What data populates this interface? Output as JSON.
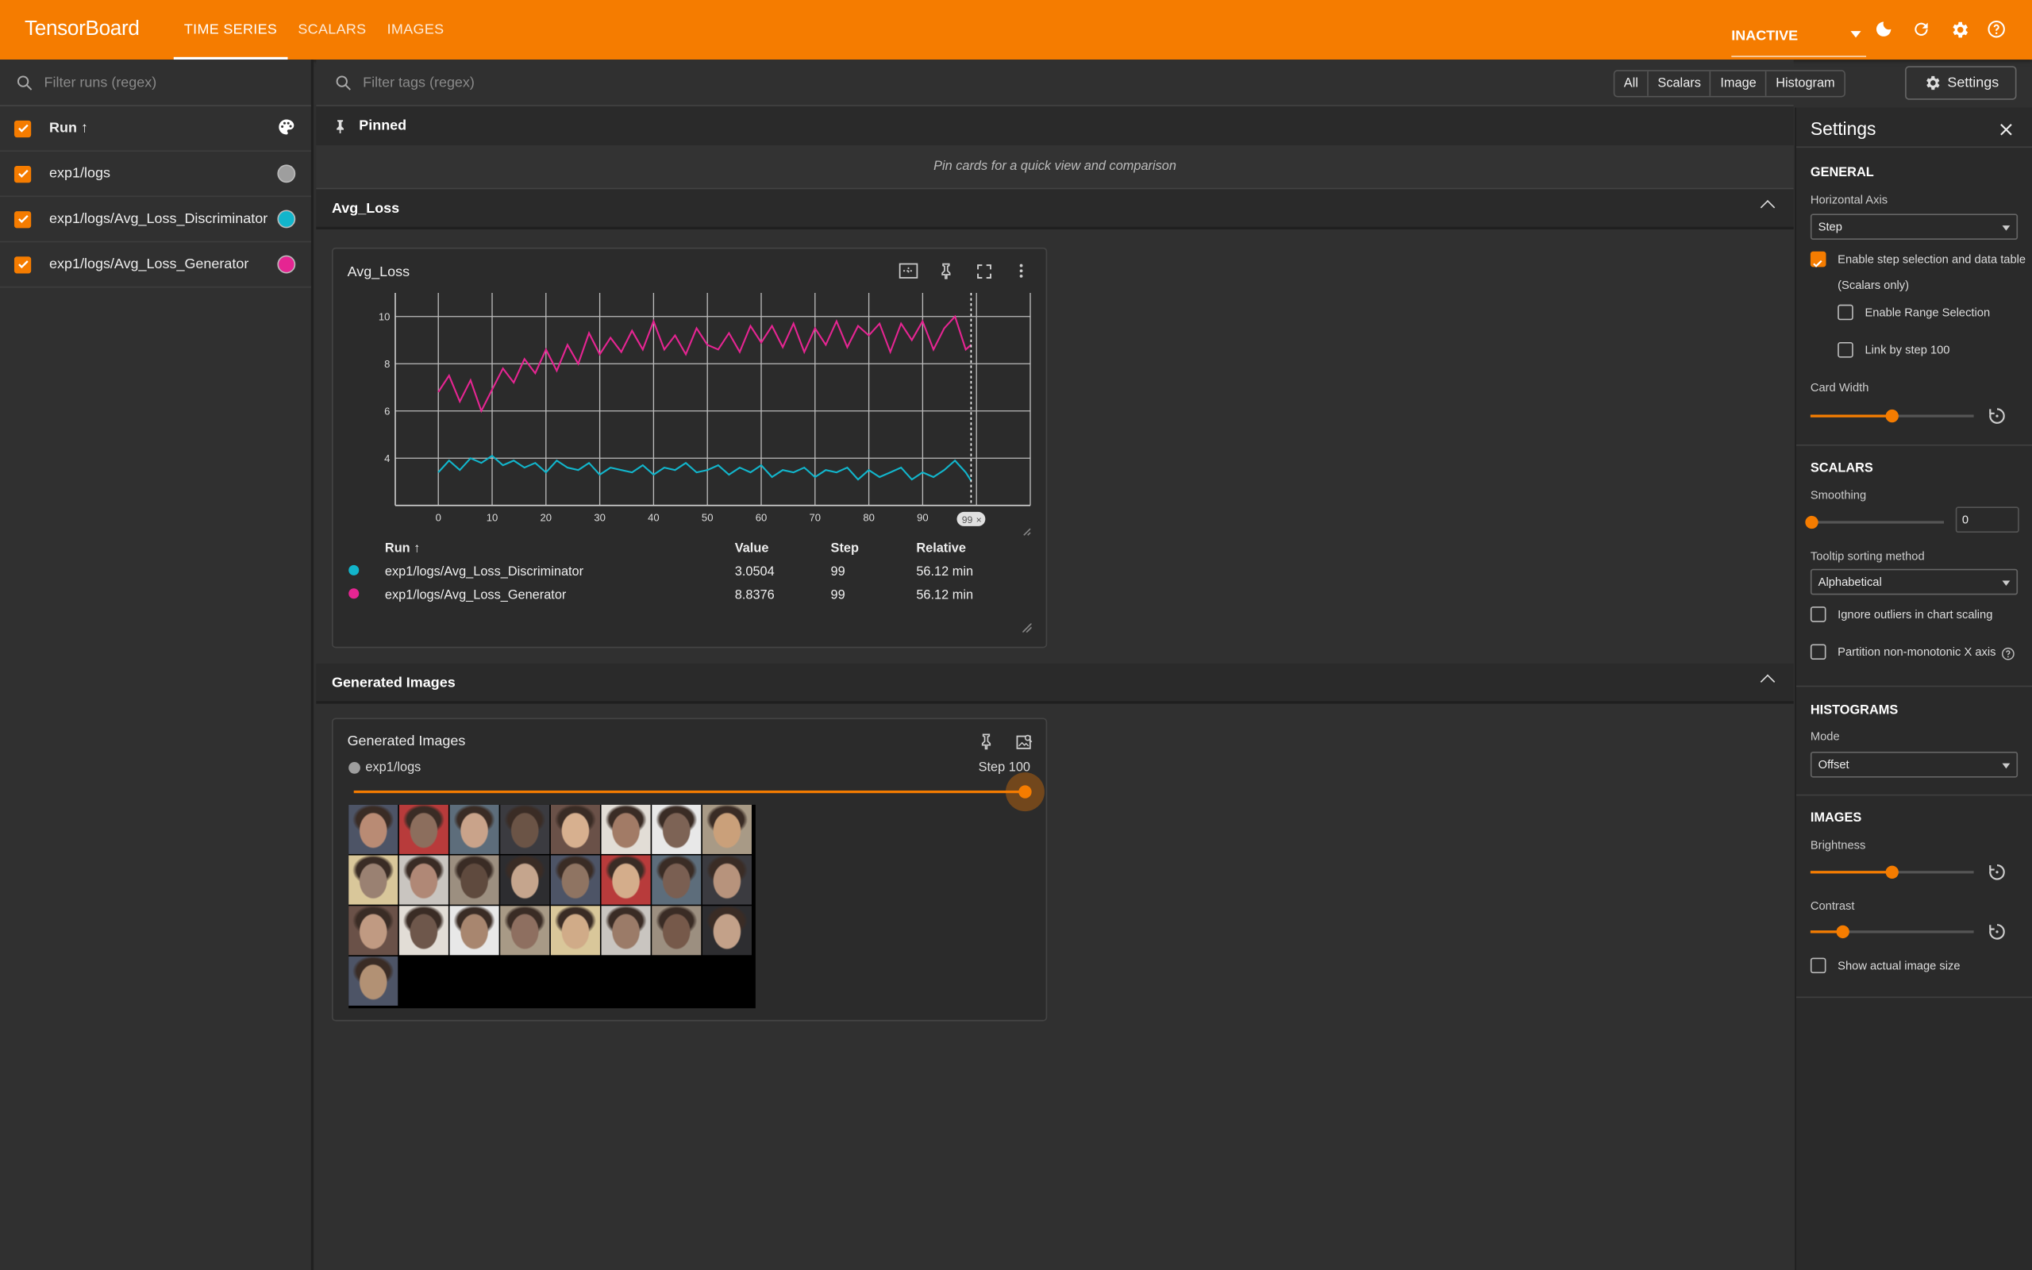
{
  "app": {
    "brand": "TensorBoard",
    "accent": "#f57c00"
  },
  "nav": {
    "tabs": [
      {
        "label": "TIME SERIES",
        "active": true
      },
      {
        "label": "SCALARS"
      },
      {
        "label": "IMAGES"
      }
    ],
    "status": "INACTIVE",
    "icons": [
      "dark-mode-icon",
      "refresh-icon",
      "gear-icon",
      "help-icon"
    ]
  },
  "runs": {
    "filter_placeholder": "Filter runs (regex)",
    "header": "Run ↑",
    "items": [
      {
        "name": "exp1/logs",
        "color": "#9e9e9e"
      },
      {
        "name": "exp1/logs/Avg_Loss_Discriminator",
        "color": "#12b5cb"
      },
      {
        "name": "exp1/logs/Avg_Loss_Generator",
        "color": "#e52592"
      }
    ]
  },
  "tags": {
    "filter_placeholder": "Filter tags (regex)",
    "types": [
      "All",
      "Scalars",
      "Image",
      "Histogram"
    ],
    "settings_label": "Settings"
  },
  "pinned": {
    "title": "Pinned",
    "hint": "Pin cards for a quick view and comparison"
  },
  "avg_section": {
    "title": "Avg_Loss"
  },
  "avg_card": {
    "title": "Avg_Loss",
    "step_marker": "99",
    "table": {
      "headers": [
        "Run ↑",
        "Value",
        "Step",
        "Relative"
      ],
      "rows": [
        {
          "run": "exp1/logs/Avg_Loss_Discriminator",
          "value": "3.0504",
          "step": "99",
          "relative": "56.12 min",
          "color": "#12b5cb"
        },
        {
          "run": "exp1/logs/Avg_Loss_Generator",
          "value": "8.8376",
          "step": "99",
          "relative": "56.12 min",
          "color": "#e52592"
        }
      ]
    }
  },
  "chart_data": {
    "type": "line",
    "title": "Avg_Loss",
    "xlabel": "",
    "ylabel": "",
    "xlim": [
      -8,
      110
    ],
    "ylim": [
      2,
      11
    ],
    "xticks": [
      0,
      10,
      20,
      30,
      40,
      50,
      60,
      70,
      80,
      90
    ],
    "yticks": [
      4,
      6,
      8,
      10
    ],
    "grid": true,
    "series": [
      {
        "name": "exp1/logs/Avg_Loss_Generator",
        "color": "#e52592",
        "x": [
          0,
          2,
          4,
          6,
          8,
          10,
          12,
          14,
          16,
          18,
          20,
          22,
          24,
          26,
          28,
          30,
          32,
          34,
          36,
          38,
          40,
          42,
          44,
          46,
          48,
          50,
          52,
          54,
          56,
          58,
          60,
          62,
          64,
          66,
          68,
          70,
          72,
          74,
          76,
          78,
          80,
          82,
          84,
          86,
          88,
          90,
          92,
          94,
          96,
          98,
          99
        ],
        "y": [
          6.8,
          7.5,
          6.4,
          7.3,
          6.0,
          6.9,
          7.8,
          7.2,
          8.2,
          7.6,
          8.6,
          7.7,
          8.8,
          8.0,
          9.3,
          8.4,
          9.1,
          8.5,
          9.4,
          8.6,
          9.8,
          8.6,
          9.2,
          8.4,
          9.5,
          8.8,
          8.6,
          9.3,
          8.5,
          9.6,
          8.9,
          9.6,
          8.7,
          9.7,
          8.5,
          9.5,
          8.8,
          9.8,
          8.7,
          9.6,
          9.2,
          9.7,
          8.5,
          9.7,
          9.0,
          9.8,
          8.6,
          9.5,
          10.0,
          8.6,
          8.8
        ]
      },
      {
        "name": "exp1/logs/Avg_Loss_Discriminator",
        "color": "#12b5cb",
        "x": [
          0,
          2,
          4,
          6,
          8,
          10,
          12,
          14,
          16,
          18,
          20,
          22,
          24,
          26,
          28,
          30,
          32,
          34,
          36,
          38,
          40,
          42,
          44,
          46,
          48,
          50,
          52,
          54,
          56,
          58,
          60,
          62,
          64,
          66,
          68,
          70,
          72,
          74,
          76,
          78,
          80,
          82,
          84,
          86,
          88,
          90,
          92,
          94,
          96,
          98,
          99
        ],
        "y": [
          3.4,
          3.9,
          3.5,
          4.0,
          3.8,
          4.1,
          3.7,
          3.9,
          3.6,
          3.8,
          3.4,
          3.9,
          3.6,
          3.5,
          3.8,
          3.3,
          3.6,
          3.5,
          3.4,
          3.7,
          3.3,
          3.6,
          3.5,
          3.8,
          3.4,
          3.5,
          3.7,
          3.3,
          3.6,
          3.4,
          3.7,
          3.2,
          3.5,
          3.4,
          3.6,
          3.2,
          3.5,
          3.4,
          3.6,
          3.1,
          3.5,
          3.2,
          3.4,
          3.6,
          3.1,
          3.4,
          3.2,
          3.5,
          3.9,
          3.4,
          3.05
        ]
      }
    ]
  },
  "img_section": {
    "title": "Generated Images"
  },
  "img_card": {
    "title": "Generated Images",
    "run": "exp1/logs",
    "step_label": "Step 100",
    "step_fraction": 1.0
  },
  "settings": {
    "title": "Settings",
    "general": {
      "header": "GENERAL",
      "h_axis_label": "Horizontal Axis",
      "h_axis_value": "Step",
      "step_sel": "Enable step selection and data table",
      "step_sel_sub": "(Scalars only)",
      "range_sel": "Enable Range Selection",
      "link_step": "Link by step 100",
      "card_width_label": "Card Width",
      "card_width_fraction": 0.5
    },
    "scalars": {
      "header": "SCALARS",
      "smoothing_label": "Smoothing",
      "smoothing_value": "0",
      "tooltip_label": "Tooltip sorting method",
      "tooltip_value": "Alphabetical",
      "ignore_outliers": "Ignore outliers in chart scaling",
      "partition": "Partition non-monotonic X axis"
    },
    "histograms": {
      "header": "HISTOGRAMS",
      "mode_label": "Mode",
      "mode_value": "Offset"
    },
    "images": {
      "header": "IMAGES",
      "brightness_label": "Brightness",
      "brightness_fraction": 0.5,
      "contrast_label": "Contrast",
      "contrast_fraction": 0.2,
      "actual_size": "Show actual image size"
    }
  }
}
